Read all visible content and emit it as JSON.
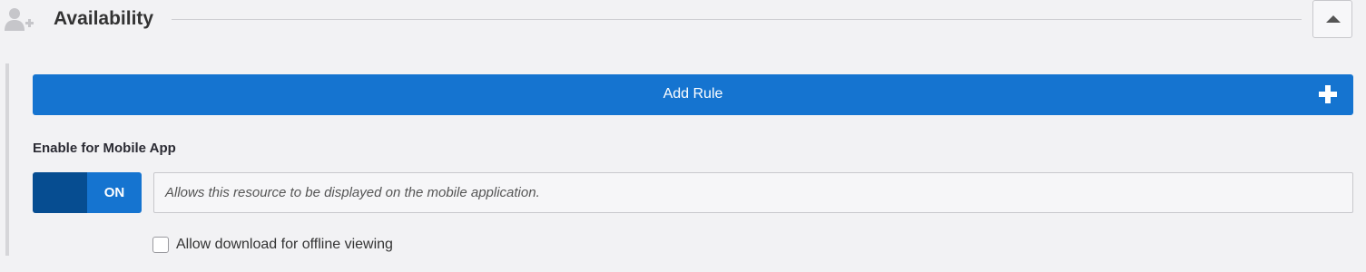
{
  "section": {
    "title": "Availability",
    "icon": "user-add-icon",
    "collapse_icon": "caret-up-icon"
  },
  "add_rule": {
    "label": "Add Rule",
    "icon": "plus-icon"
  },
  "mobile_app": {
    "label": "Enable for Mobile App",
    "toggle_state": "ON",
    "description": "Allows this resource to be displayed on the mobile application."
  },
  "offline": {
    "label": "Allow download for offline viewing",
    "checked": false
  },
  "colors": {
    "accent": "#1574d0",
    "toggle_knob": "#064d91",
    "background": "#f2f2f4"
  }
}
